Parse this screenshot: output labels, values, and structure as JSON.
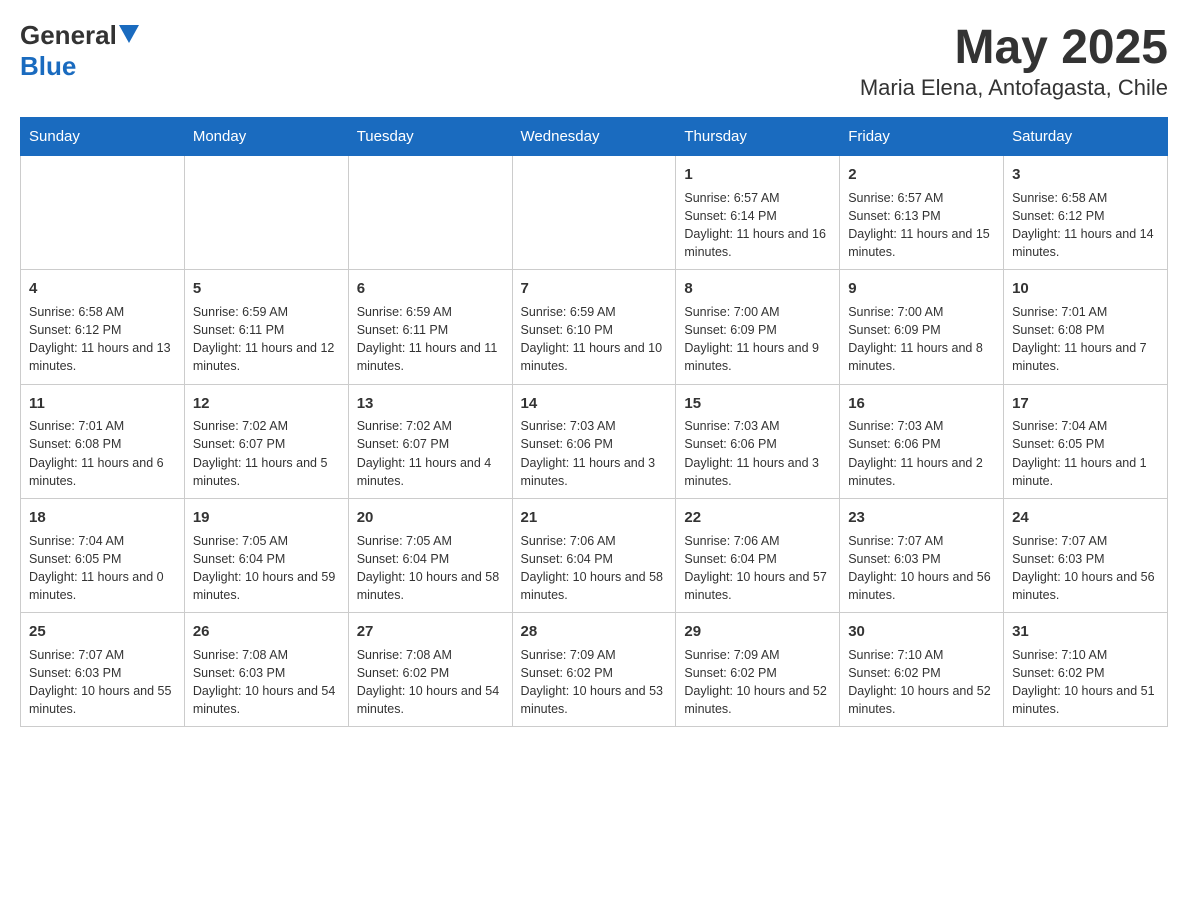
{
  "header": {
    "logo_general": "General",
    "logo_blue": "Blue",
    "month_year": "May 2025",
    "location": "Maria Elena, Antofagasta, Chile"
  },
  "days_of_week": [
    "Sunday",
    "Monday",
    "Tuesday",
    "Wednesday",
    "Thursday",
    "Friday",
    "Saturday"
  ],
  "weeks": [
    [
      {
        "day": "",
        "info": ""
      },
      {
        "day": "",
        "info": ""
      },
      {
        "day": "",
        "info": ""
      },
      {
        "day": "",
        "info": ""
      },
      {
        "day": "1",
        "info": "Sunrise: 6:57 AM\nSunset: 6:14 PM\nDaylight: 11 hours and 16 minutes."
      },
      {
        "day": "2",
        "info": "Sunrise: 6:57 AM\nSunset: 6:13 PM\nDaylight: 11 hours and 15 minutes."
      },
      {
        "day": "3",
        "info": "Sunrise: 6:58 AM\nSunset: 6:12 PM\nDaylight: 11 hours and 14 minutes."
      }
    ],
    [
      {
        "day": "4",
        "info": "Sunrise: 6:58 AM\nSunset: 6:12 PM\nDaylight: 11 hours and 13 minutes."
      },
      {
        "day": "5",
        "info": "Sunrise: 6:59 AM\nSunset: 6:11 PM\nDaylight: 11 hours and 12 minutes."
      },
      {
        "day": "6",
        "info": "Sunrise: 6:59 AM\nSunset: 6:11 PM\nDaylight: 11 hours and 11 minutes."
      },
      {
        "day": "7",
        "info": "Sunrise: 6:59 AM\nSunset: 6:10 PM\nDaylight: 11 hours and 10 minutes."
      },
      {
        "day": "8",
        "info": "Sunrise: 7:00 AM\nSunset: 6:09 PM\nDaylight: 11 hours and 9 minutes."
      },
      {
        "day": "9",
        "info": "Sunrise: 7:00 AM\nSunset: 6:09 PM\nDaylight: 11 hours and 8 minutes."
      },
      {
        "day": "10",
        "info": "Sunrise: 7:01 AM\nSunset: 6:08 PM\nDaylight: 11 hours and 7 minutes."
      }
    ],
    [
      {
        "day": "11",
        "info": "Sunrise: 7:01 AM\nSunset: 6:08 PM\nDaylight: 11 hours and 6 minutes."
      },
      {
        "day": "12",
        "info": "Sunrise: 7:02 AM\nSunset: 6:07 PM\nDaylight: 11 hours and 5 minutes."
      },
      {
        "day": "13",
        "info": "Sunrise: 7:02 AM\nSunset: 6:07 PM\nDaylight: 11 hours and 4 minutes."
      },
      {
        "day": "14",
        "info": "Sunrise: 7:03 AM\nSunset: 6:06 PM\nDaylight: 11 hours and 3 minutes."
      },
      {
        "day": "15",
        "info": "Sunrise: 7:03 AM\nSunset: 6:06 PM\nDaylight: 11 hours and 3 minutes."
      },
      {
        "day": "16",
        "info": "Sunrise: 7:03 AM\nSunset: 6:06 PM\nDaylight: 11 hours and 2 minutes."
      },
      {
        "day": "17",
        "info": "Sunrise: 7:04 AM\nSunset: 6:05 PM\nDaylight: 11 hours and 1 minute."
      }
    ],
    [
      {
        "day": "18",
        "info": "Sunrise: 7:04 AM\nSunset: 6:05 PM\nDaylight: 11 hours and 0 minutes."
      },
      {
        "day": "19",
        "info": "Sunrise: 7:05 AM\nSunset: 6:04 PM\nDaylight: 10 hours and 59 minutes."
      },
      {
        "day": "20",
        "info": "Sunrise: 7:05 AM\nSunset: 6:04 PM\nDaylight: 10 hours and 58 minutes."
      },
      {
        "day": "21",
        "info": "Sunrise: 7:06 AM\nSunset: 6:04 PM\nDaylight: 10 hours and 58 minutes."
      },
      {
        "day": "22",
        "info": "Sunrise: 7:06 AM\nSunset: 6:04 PM\nDaylight: 10 hours and 57 minutes."
      },
      {
        "day": "23",
        "info": "Sunrise: 7:07 AM\nSunset: 6:03 PM\nDaylight: 10 hours and 56 minutes."
      },
      {
        "day": "24",
        "info": "Sunrise: 7:07 AM\nSunset: 6:03 PM\nDaylight: 10 hours and 56 minutes."
      }
    ],
    [
      {
        "day": "25",
        "info": "Sunrise: 7:07 AM\nSunset: 6:03 PM\nDaylight: 10 hours and 55 minutes."
      },
      {
        "day": "26",
        "info": "Sunrise: 7:08 AM\nSunset: 6:03 PM\nDaylight: 10 hours and 54 minutes."
      },
      {
        "day": "27",
        "info": "Sunrise: 7:08 AM\nSunset: 6:02 PM\nDaylight: 10 hours and 54 minutes."
      },
      {
        "day": "28",
        "info": "Sunrise: 7:09 AM\nSunset: 6:02 PM\nDaylight: 10 hours and 53 minutes."
      },
      {
        "day": "29",
        "info": "Sunrise: 7:09 AM\nSunset: 6:02 PM\nDaylight: 10 hours and 52 minutes."
      },
      {
        "day": "30",
        "info": "Sunrise: 7:10 AM\nSunset: 6:02 PM\nDaylight: 10 hours and 52 minutes."
      },
      {
        "day": "31",
        "info": "Sunrise: 7:10 AM\nSunset: 6:02 PM\nDaylight: 10 hours and 51 minutes."
      }
    ]
  ]
}
